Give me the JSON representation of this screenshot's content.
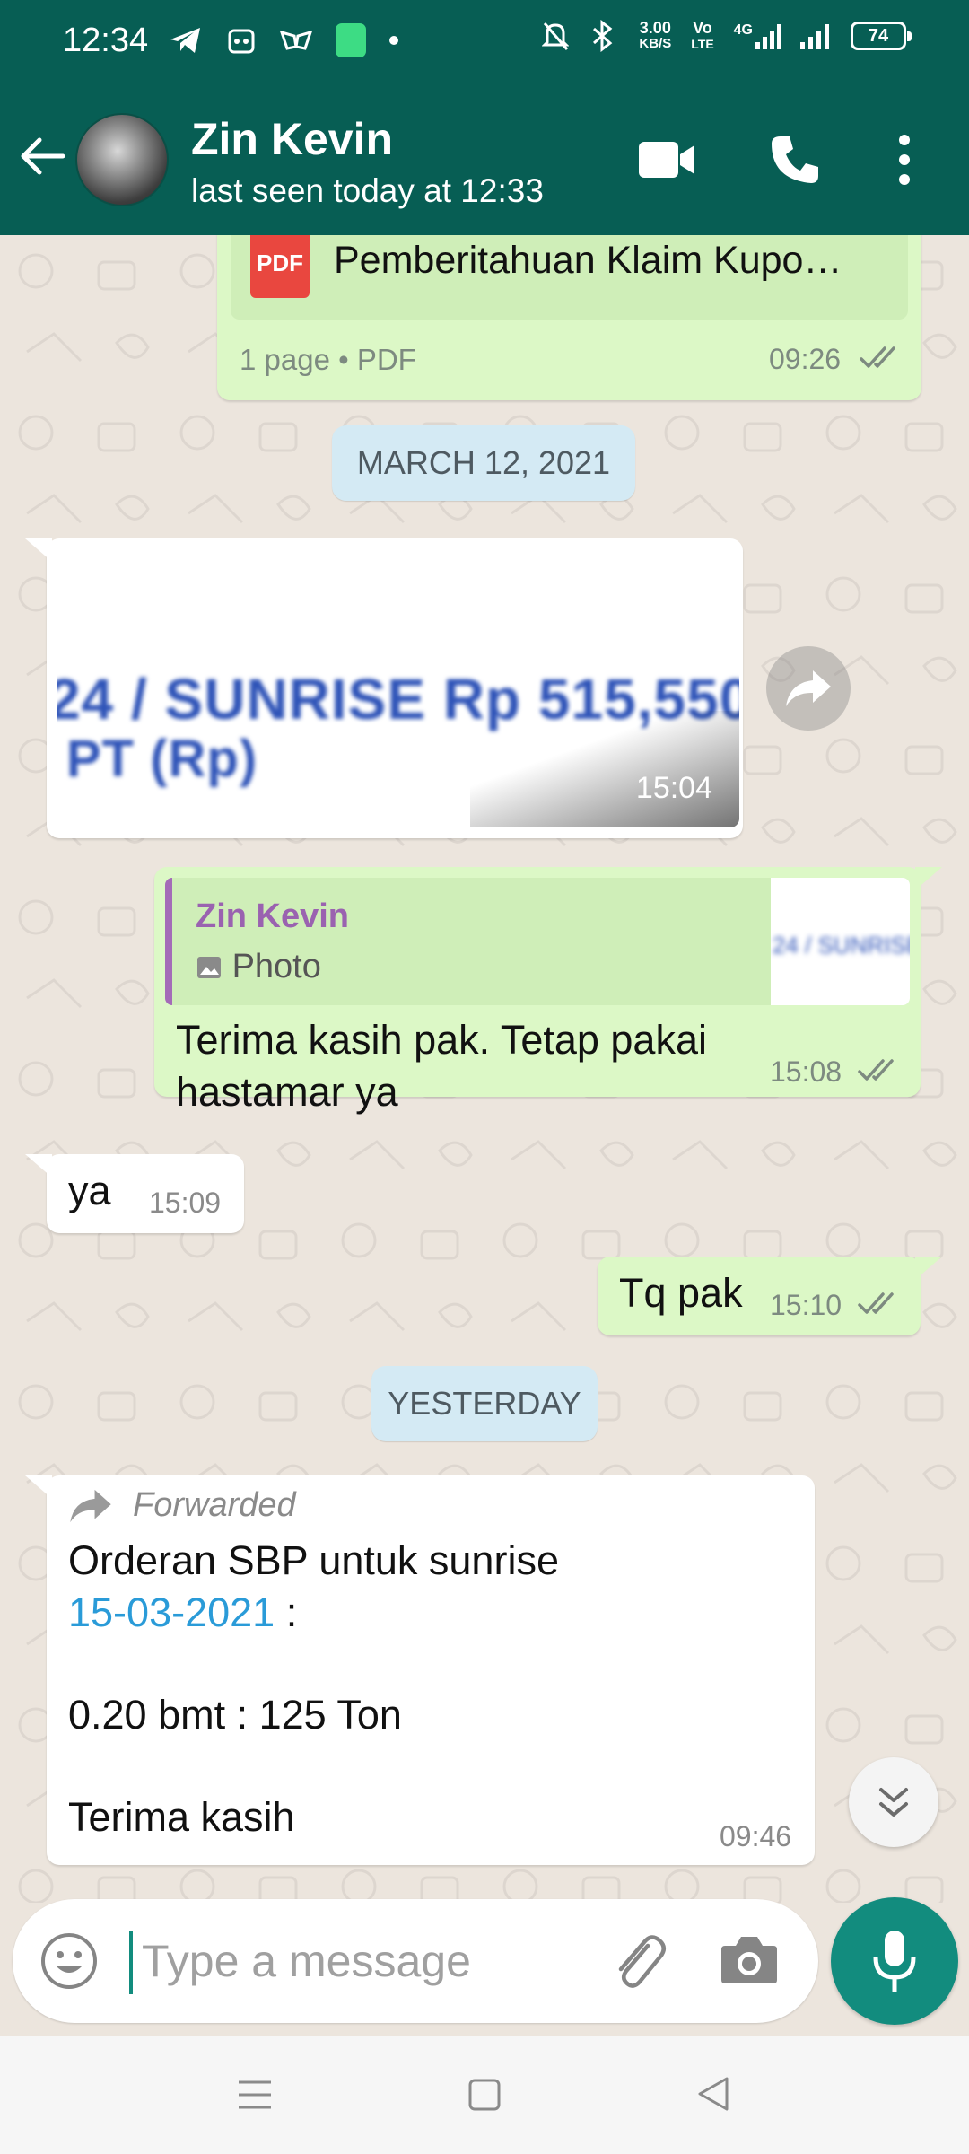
{
  "status_bar": {
    "time": "12:34",
    "net_speed_top": "3.00",
    "net_speed_bottom": "KB/S",
    "volte_top": "Vo",
    "volte_bottom": "LTE",
    "net_type": "4G",
    "battery": "74"
  },
  "header": {
    "contact_name": "Zin Kevin",
    "last_seen": "last seen today at 12:33"
  },
  "messages": {
    "pdf": {
      "file_name": "Pemberitahuan Klaim Kupo…",
      "icon_label": "PDF",
      "meta": "1 page • PDF",
      "time": "09:26"
    },
    "date_chip_1": "MARCH 12, 2021",
    "image_msg": {
      "line1": "24 / SUNRISE Rp 515,550,",
      "line2": "PT (Rp)",
      "time": "15:04"
    },
    "reply_msg": {
      "quote_name": "Zin Kevin",
      "quote_type": "Photo",
      "text_line1": "Terima kasih pak. Tetap pakai",
      "text_line2": "hastamar ya",
      "time": "15:08"
    },
    "ya_msg": {
      "text": "ya",
      "time": "15:09"
    },
    "tq_msg": {
      "text": "Tq pak",
      "time": "15:10"
    },
    "date_chip_2": "YESTERDAY",
    "forwarded_msg": {
      "label": "Forwarded",
      "line1": "Orderan SBP untuk sunrise",
      "date_link": "15-03-2021",
      "line2_suffix": " :",
      "line3": "0.20 bmt : 125 Ton",
      "line4": "Terima kasih",
      "time": "09:46"
    }
  },
  "input": {
    "placeholder": "Type a message"
  },
  "colors": {
    "header": "#075e54",
    "outgoing_bubble": "#dcf8c6",
    "incoming_bubble": "#ffffff",
    "accent": "#128c7e",
    "read_ticks": "#7d8a80",
    "link": "#2a9bd8"
  },
  "icons": [
    "back-arrow-icon",
    "video-call-icon",
    "phone-icon",
    "more-vert-icon",
    "forward-icon",
    "double-chevron-down-icon",
    "emoji-icon",
    "attach-icon",
    "camera-icon",
    "mic-icon"
  ]
}
